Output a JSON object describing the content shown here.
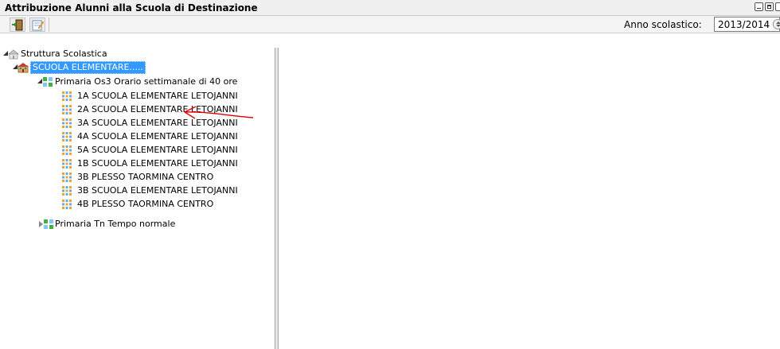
{
  "window": {
    "title": "Attribuzione Alunni alla Scuola di Destinazione"
  },
  "toolbar": {
    "exit_icon": "exit-door-icon",
    "edit_icon": "edit-note-icon",
    "year_label": "Anno scolastico:",
    "year_value": "2013/2014"
  },
  "tree": {
    "root": {
      "label": "Struttura Scolastica",
      "icon": "school-building-icon",
      "expanded": true
    },
    "school": {
      "label": "SCUOLA ELEMENTARE.....",
      "icon": "school-icon",
      "expanded": true,
      "selected": true
    },
    "groups": [
      {
        "label": "Primaria Os3 Orario settimanale di 40 ore",
        "icon": "grid-group-icon",
        "expanded": true,
        "classes": [
          "1A SCUOLA ELEMENTARE LETOJANNI",
          "2A SCUOLA ELEMENTARE LETOJANNI",
          "3A SCUOLA ELEMENTARE LETOJANNI",
          "4A SCUOLA ELEMENTARE LETOJANNI",
          "5A SCUOLA ELEMENTARE LETOJANNI",
          "1B SCUOLA ELEMENTARE LETOJANNI",
          "3B PLESSO TAORMINA CENTRO",
          "3B SCUOLA ELEMENTARE LETOJANNI",
          "4B PLESSO TAORMINA CENTRO"
        ]
      },
      {
        "label": "Primaria Tn Tempo normale",
        "icon": "grid-group-icon",
        "expanded": false,
        "classes": []
      }
    ]
  },
  "colors": {
    "selection": "#3399ff",
    "annotation": "#e00000"
  }
}
